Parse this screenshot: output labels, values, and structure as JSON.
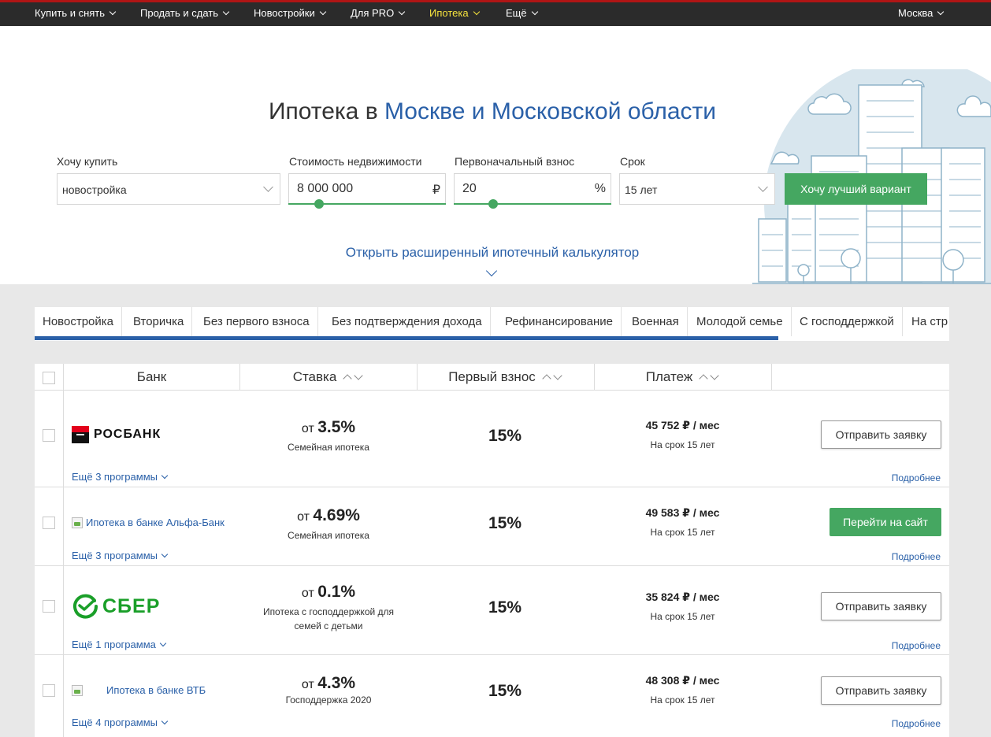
{
  "nav": {
    "items": [
      {
        "label": "Купить и снять"
      },
      {
        "label": "Продать и сдать"
      },
      {
        "label": "Новостройки"
      },
      {
        "label": "Для PRO"
      },
      {
        "label": "Ипотека"
      },
      {
        "label": "Ещё"
      }
    ],
    "city": "Москва",
    "active_color": "#f5e33d"
  },
  "hero": {
    "title_prefix": "Ипотека в ",
    "title_region": "Москве и Московской области",
    "fields": {
      "want_label": "Хочу купить",
      "want_value": "новостройка",
      "price_label": "Стоимость недвижимости",
      "price_value": "8 000 000",
      "price_unit": "₽",
      "down_label": "Первоначальный взнос",
      "down_value": "20",
      "down_unit": "%",
      "term_label": "Срок",
      "term_value": "15 лет"
    },
    "cta": "Хочу лучший вариант",
    "calc_link": "Открыть расширенный ипотечный калькулятор"
  },
  "tabs": [
    "Новостройка",
    "Вторичка",
    "Без первого взноса",
    "Без подтверждения дохода",
    "Рефинансирование",
    "Военная",
    "Молодой семье",
    "С господдержкой",
    "На стр"
  ],
  "table": {
    "headers": {
      "bank": "Банк",
      "rate": "Ставка",
      "down": "Первый взнос",
      "payment": "Платеж"
    },
    "rows": [
      {
        "bank": "РОСБАНК",
        "rate_prefix": "от ",
        "rate": "3.5%",
        "program": "Семейная ипотека",
        "down": "15%",
        "payment": "45 752 ₽ / мес",
        "term": "На срок 15 лет",
        "action": "Отправить заявку",
        "more": "Ещё 3 программы",
        "details": "Подробнее"
      },
      {
        "bank": "Ипотека в банке Альфа-Банк",
        "rate_prefix": "от ",
        "rate": "4.69%",
        "program": "Семейная ипотека",
        "down": "15%",
        "payment": "49 583 ₽ / мес",
        "term": "На срок 15 лет",
        "action": "Перейти на сайт",
        "more": "Ещё 3 программы",
        "details": "Подробнее"
      },
      {
        "bank": "СБЕР",
        "rate_prefix": "от ",
        "rate": "0.1%",
        "program": "Ипотека с господдержкой для семей с детьми",
        "down": "15%",
        "payment": "35 824 ₽ / мес",
        "term": "На срок 15 лет",
        "action": "Отправить заявку",
        "more": "Ещё 1 программа",
        "details": "Подробнее"
      },
      {
        "bank": "Ипотека в банке ВТБ",
        "rate_prefix": "от ",
        "rate": "4.3%",
        "program": "Господдержка 2020",
        "down": "15%",
        "payment": "48 308 ₽ / мес",
        "term": "На срок 15 лет",
        "action": "Отправить заявку",
        "more": "Ещё 4 программы",
        "details": "Подробнее"
      }
    ]
  },
  "colors": {
    "accent_blue": "#2a60a8",
    "accent_green": "#45a761",
    "nav_bg": "#2b2b2b",
    "sber_green": "#1a9f29",
    "rosbank_red": "#e3001b"
  }
}
